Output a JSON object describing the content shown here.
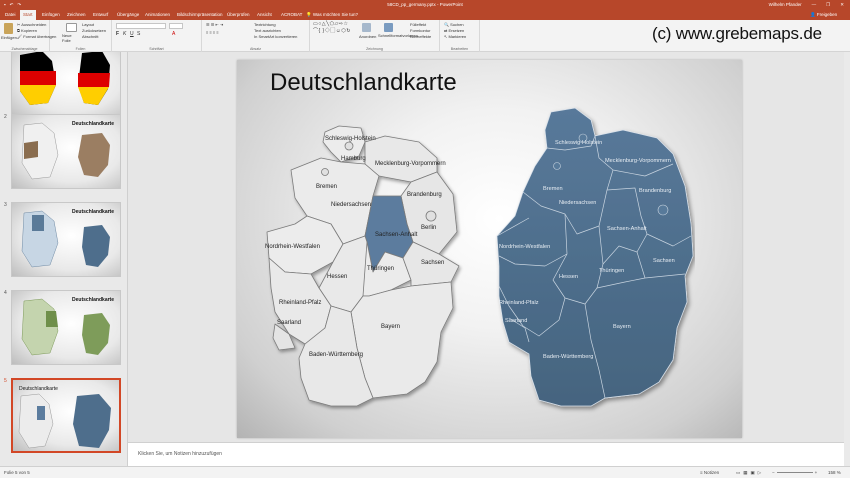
{
  "window": {
    "title": "58CD_pp_germany.pptx - PowerPoint",
    "user": "Wilhelm Pfander",
    "controls": [
      "—",
      "❐",
      "✕"
    ]
  },
  "tabs": [
    {
      "label": "Datei"
    },
    {
      "label": "Start",
      "active": true
    },
    {
      "label": "Einfügen"
    },
    {
      "label": "Zeichnen"
    },
    {
      "label": "Entwurf"
    },
    {
      "label": "Übergänge"
    },
    {
      "label": "Animationen"
    },
    {
      "label": "Bildschirmpräsentation"
    },
    {
      "label": "Überprüfen"
    },
    {
      "label": "Ansicht"
    },
    {
      "label": "ACROBAT"
    }
  ],
  "tell_me": "Was möchten Sie tun?",
  "share": "Freigeben",
  "ribbon": {
    "clipboard": {
      "paste": "Einfügen",
      "cut": "Ausschneiden",
      "copy": "Kopieren",
      "format_painter": "Format übertragen",
      "label": "Zwischenablage"
    },
    "slides": {
      "new": "Neue Folie",
      "layout": "Layout",
      "reset": "Zurücksetzen",
      "section": "Abschnitt",
      "label": "Folien"
    },
    "font": {
      "label": "Schriftart"
    },
    "paragraph": {
      "direction": "Textrichtung",
      "align": "Text ausrichten",
      "smartart": "In SmartArt konvertieren",
      "label": "Absatz"
    },
    "drawing": {
      "arrange": "Anordnen",
      "styles": "Schnellformatvorlagen",
      "fill": "Fülleffekt",
      "outline": "Formkontur",
      "effects": "Formeffekte",
      "label": "Zeichnung"
    },
    "editing": {
      "find": "Suchen",
      "replace": "Ersetzen",
      "select": "Markieren",
      "label": "Bearbeiten"
    }
  },
  "watermark": "(c) www.grebemaps.de",
  "thumbnails": [
    {
      "number": "",
      "title": ""
    },
    {
      "number": "2",
      "title": "Deutschlandkarte"
    },
    {
      "number": "3",
      "title": "Deutschlandkarte"
    },
    {
      "number": "4",
      "title": "Deutschlandkarte"
    },
    {
      "number": "5",
      "title": "Deutschlandkarte"
    }
  ],
  "slide": {
    "title": "Deutschlandkarte",
    "states": [
      "Schleswig-Holstein",
      "Hamburg",
      "Mecklenburg-Vorpommern",
      "Bremen",
      "Niedersachsen",
      "Berlin",
      "Brandenburg",
      "Sachsen-Anhalt",
      "Nordrhein-Westfalen",
      "Hessen",
      "Thüringen",
      "Sachsen",
      "Rheinland-Pfalz",
      "Saarland",
      "Bayern",
      "Baden-Württemberg"
    ]
  },
  "notes_placeholder": "Klicken Sie, um Notizen hinzuzufügen",
  "status": {
    "slide_of": "Folie 5 von 5",
    "notes": "Notizen",
    "zoom": "158 %"
  },
  "colors": {
    "accent": "#b7472a",
    "map_blue": "#4e6e8c",
    "map_gray": "#e4e4e4",
    "highlight": "#5b7c9e"
  }
}
